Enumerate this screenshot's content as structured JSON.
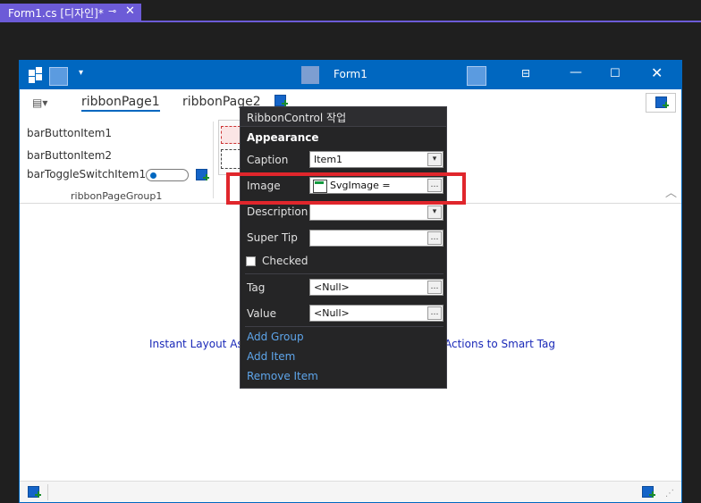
{
  "document_tab": {
    "title": "Form1.cs [디자인]*",
    "pin_glyph": "⊸",
    "close_glyph": "✕"
  },
  "form": {
    "title": "Form1",
    "quick_access_dropdown": "▾",
    "window_buttons": {
      "ribbon_options": "⊟",
      "minimize": "—",
      "maximize": "☐",
      "close": "✕"
    },
    "ribbon_tabs": [
      "ribbonPage1",
      "ribbonPage2"
    ],
    "app_menu_glyph": "▤▾",
    "page_group": {
      "items": [
        "barButtonItem1",
        "barButtonItem2",
        "barToggleSwitchItem1"
      ],
      "group_label": "ribbonPageGroup1"
    },
    "collapse_glyph": "︿",
    "layout_hint_left": "Instant Layout Ass",
    "layout_hint_right": "Actions to Smart Tag",
    "status_grip": "⋰"
  },
  "smart_tag_panel": {
    "header": "RibbonControl 작업",
    "section": "Appearance",
    "fields": {
      "caption": {
        "label": "Caption",
        "value": "Item1",
        "button": "▾"
      },
      "image": {
        "label": "Image",
        "value": "SvgImage =",
        "button": "…"
      },
      "description": {
        "label": "Description",
        "value": "",
        "button": "▾"
      },
      "super_tip": {
        "label": "Super Tip",
        "value": "",
        "button": "…"
      },
      "checked": {
        "label": "Checked"
      },
      "tag": {
        "label": "Tag",
        "value": "<Null>",
        "button": "…"
      },
      "value": {
        "label": "Value",
        "value": "<Null>",
        "button": "…"
      }
    },
    "links": [
      "Add Group",
      "Add Item",
      "Remove Item"
    ]
  },
  "colors": {
    "accent_purple": "#6c5bd7",
    "form_blue": "#0067c0",
    "highlight_red": "#e0262c",
    "link_blue": "#5ea5ea"
  }
}
